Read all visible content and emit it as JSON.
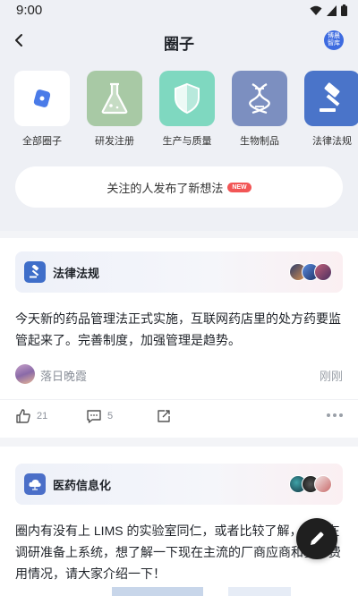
{
  "status_bar": {
    "time": "9:00",
    "icons": [
      "wifi-icon",
      "signal-icon",
      "battery-icon"
    ]
  },
  "header": {
    "title": "圈子",
    "badge_text": "博晨\n智库",
    "back_icon": "chevron-left-icon"
  },
  "categories": [
    {
      "label": "全部圈子",
      "icon": "circle-tag-icon",
      "color": "#ffffff"
    },
    {
      "label": "研发注册",
      "icon": "flask-icon",
      "color": "#a8c9a5"
    },
    {
      "label": "生产与质量",
      "icon": "shield-icon",
      "color": "#7fd8c0"
    },
    {
      "label": "生物制品",
      "icon": "dna-icon",
      "color": "#7c8fc0"
    },
    {
      "label": "法律法规",
      "icon": "gavel-icon",
      "color": "#4a74c9"
    }
  ],
  "notification": {
    "text": "关注的人发布了新想法",
    "badge": "NEW"
  },
  "posts": [
    {
      "topic": "法律法规",
      "topic_icon": "gavel-icon",
      "topic_color": "#3f6ec9",
      "text": "今天新的药品管理法正式实施，互联网药店里的处方药要监管起来了。完善制度，加强管理是趋势。",
      "author": "落日晚霞",
      "time": "刚刚",
      "likes": "21",
      "comments": "5"
    },
    {
      "topic": "医药信息化",
      "topic_icon": "cloud-icon",
      "topic_color": "#4b6fc8",
      "text": "圈内有没有上 LIMS 的实验室同仁，或者比较了解，最近在调研准备上系统，想了解一下现在主流的厂商应商和基本费用情况，请大家介绍一下！"
    }
  ],
  "fab": {
    "icon": "pencil-icon"
  }
}
